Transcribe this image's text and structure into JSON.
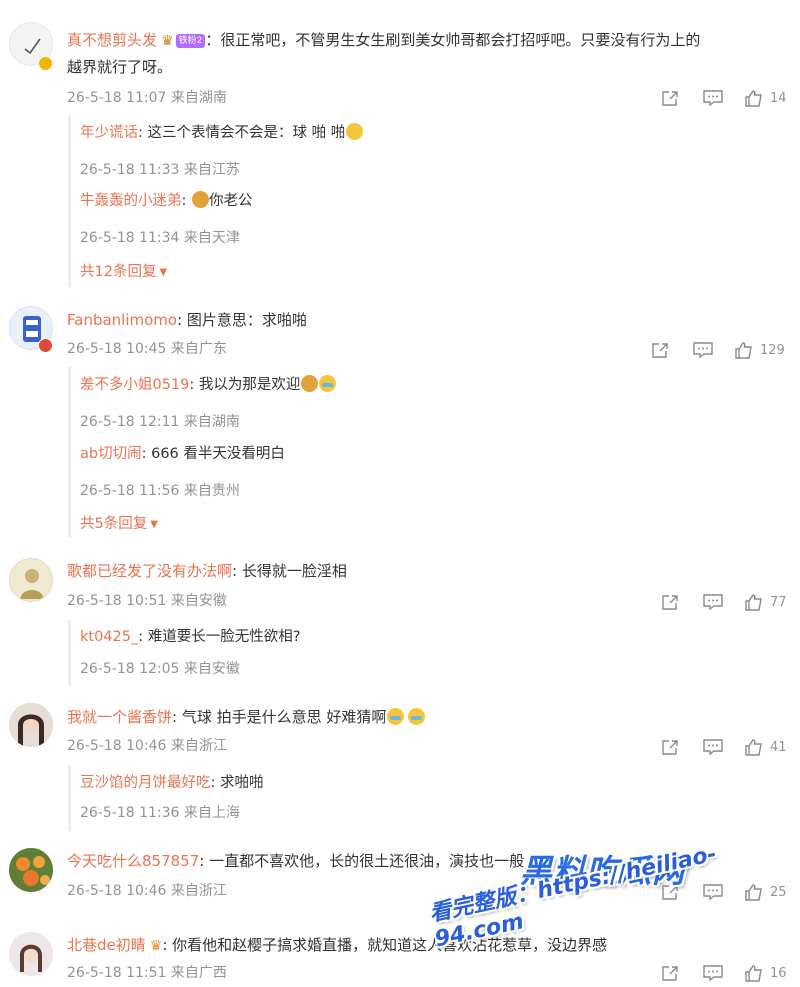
{
  "comments": [
    {
      "user": "真不想剪头发",
      "badge": "铁粉2",
      "text": "很正常吧，不管男生女生刷到美女帅哥都会打招呼吧。只要没有行为上的",
      "text2": "越界就行了呀。",
      "time": "26-5-18 11:07 来自湖南",
      "likes": "14",
      "replies": [
        {
          "user": "年少谎话",
          "text": "这三个表情会不会是：球 啪 啪",
          "time": "26-5-18 11:33 来自江苏"
        },
        {
          "user": "牛轰轰的小迷弟",
          "text": "你老公",
          "time": "26-5-18 11:34 来自天津"
        }
      ],
      "more": "共12条回复"
    },
    {
      "user": "Fanbanlimomo",
      "text": "图片意思：求啪啪",
      "time": "26-5-18 10:45 来自广东",
      "likes": "129",
      "replies": [
        {
          "user": "差不多小姐0519",
          "text": "我以为那是欢迎",
          "time": "26-5-18 12:11 来自湖南"
        },
        {
          "user": "ab切切闹",
          "text": "666 看半天没看明白",
          "time": "26-5-18 11:56 来自贵州"
        }
      ],
      "more": "共5条回复"
    },
    {
      "user": "歌都已经发了没有办法啊",
      "text": "长得就一脸淫相",
      "time": "26-5-18 10:51 来自安徽",
      "likes": "77",
      "replies": [
        {
          "user": "kt0425_",
          "text": "难道要长一脸无性欲相?",
          "time": "26-5-18 12:05 来自安徽"
        }
      ]
    },
    {
      "user": "我就一个酱香饼",
      "text": "气球 拍手是什么意思 好难猜啊",
      "time": "26-5-18 10:46 来自浙江",
      "likes": "41",
      "replies": [
        {
          "user": "豆沙馅的月饼最好吃",
          "text": "求啪啪",
          "time": "26-5-18 11:36 来自上海"
        }
      ]
    },
    {
      "user": "今天吃什么857857",
      "text": "一直都不喜欢他，长的很土还很油，演技也一般",
      "time": "26-5-18 10:46 来自浙江",
      "likes": "25"
    },
    {
      "user": "北巷de初睛",
      "text": "你看他和赵樱子搞求婚直播，就知道这人喜欢沾花惹草，没边界感",
      "time": "26-5-18 11:51 来自广西",
      "likes": "16"
    }
  ],
  "watermark": {
    "title": "黑料吃瓜网",
    "url": "看完整版：https://heiliao-94.com"
  },
  "colors": {
    "username": "#eb7350",
    "meta": "#939393",
    "watermark": "#2a6be0"
  }
}
